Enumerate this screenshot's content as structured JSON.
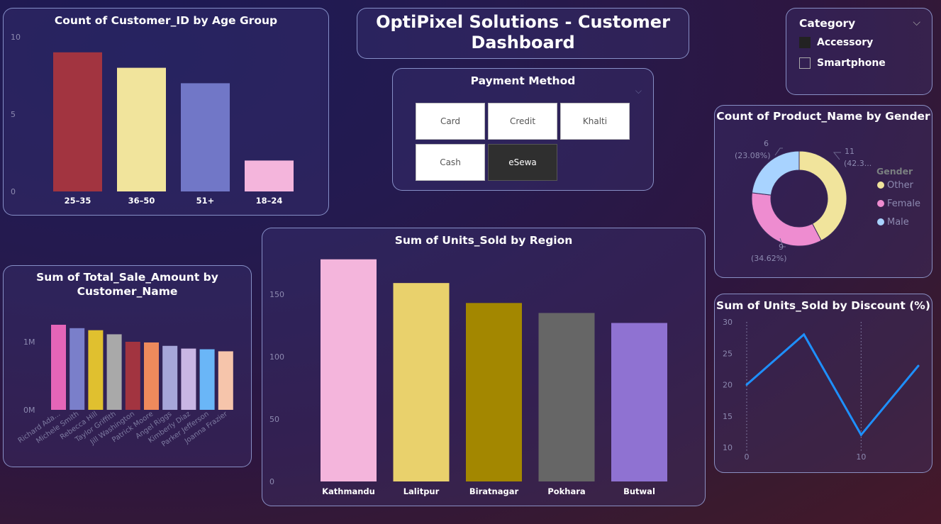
{
  "title_panel": {
    "title": "OptiPixel Solutions - Customer Dashboard"
  },
  "payment": {
    "title": "Payment Method",
    "buttons": [
      "Card",
      "Credit",
      "Khalti",
      "Cash",
      "eSewa"
    ],
    "selected": "eSewa"
  },
  "category": {
    "title": "Category",
    "items": [
      {
        "label": "Accessory",
        "checked": true
      },
      {
        "label": "Smartphone",
        "checked": false
      }
    ]
  },
  "chart_data": [
    {
      "id": "age",
      "type": "bar",
      "title": "Count of Customer_ID by Age Group",
      "categories": [
        "25–35",
        "36–50",
        "51+",
        "18–24"
      ],
      "values": [
        9,
        8,
        7,
        2
      ],
      "colors": [
        "#a23440",
        "#f1e49c",
        "#7177c7",
        "#f4b5dc"
      ],
      "ylim": [
        0,
        10
      ],
      "yticks": [
        "0",
        "5",
        "10"
      ]
    },
    {
      "id": "customer",
      "type": "bar",
      "title": "Sum of Total_Sale_Amount by Customer_Name",
      "categories": [
        "Richard Ada...",
        "Michele Smith",
        "Rebecca Hill",
        "Taylor Griffith",
        "Jill Washington",
        "Patrick Moore",
        "Angel Riggs",
        "Kimberly Diaz",
        "Parker Jefferson",
        "Joanna Frazier"
      ],
      "values": [
        1250000,
        1200000,
        1170000,
        1110000,
        1000000,
        990000,
        940000,
        900000,
        890000,
        860000
      ],
      "colors": [
        "#e565b8",
        "#7a7fca",
        "#e0c02f",
        "#a9a9a9",
        "#a23440",
        "#ee8a5c",
        "#a6a6d9",
        "#c9b6e4",
        "#6ab6f7",
        "#f6c5ab"
      ],
      "ylim": [
        0,
        1000000
      ],
      "yticks": [
        "0M",
        "1M"
      ]
    },
    {
      "id": "region",
      "type": "bar",
      "title": "Sum of Units_Sold by Region",
      "categories": [
        "Kathmandu",
        "Lalitpur",
        "Biratnagar",
        "Pokhara",
        "Butwal"
      ],
      "values": [
        178,
        159,
        143,
        135,
        127
      ],
      "colors": [
        "#f4b5dc",
        "#e9d16c",
        "#a38700",
        "#666666",
        "#8f72d2"
      ],
      "ylim": [
        0,
        150
      ],
      "yticks": [
        "0",
        "50",
        "100",
        "150"
      ]
    },
    {
      "id": "gender",
      "type": "pie",
      "title": "Count of Product_Name by Gender",
      "legend_title": "Gender",
      "categories": [
        "Other",
        "Female",
        "Male"
      ],
      "values": [
        11,
        9,
        6
      ],
      "labels": [
        {
          "count": "11",
          "pct": "(42.3..."
        },
        {
          "count": "9",
          "pct": "(34.62%)"
        },
        {
          "count": "6",
          "pct": "(23.08%)"
        }
      ],
      "colors": [
        "#f1e49c",
        "#ee8cd0",
        "#a8d3ff"
      ]
    },
    {
      "id": "discount",
      "type": "line",
      "title": "Sum of Units_Sold by Discount (%)",
      "x": [
        0,
        5,
        10,
        15
      ],
      "values": [
        20,
        28,
        12,
        23
      ],
      "color": "#1e90ff",
      "ylim": [
        10,
        30
      ],
      "yticks": [
        "10",
        "15",
        "20",
        "25",
        "30"
      ],
      "xticks": [
        "0",
        "10"
      ]
    }
  ]
}
